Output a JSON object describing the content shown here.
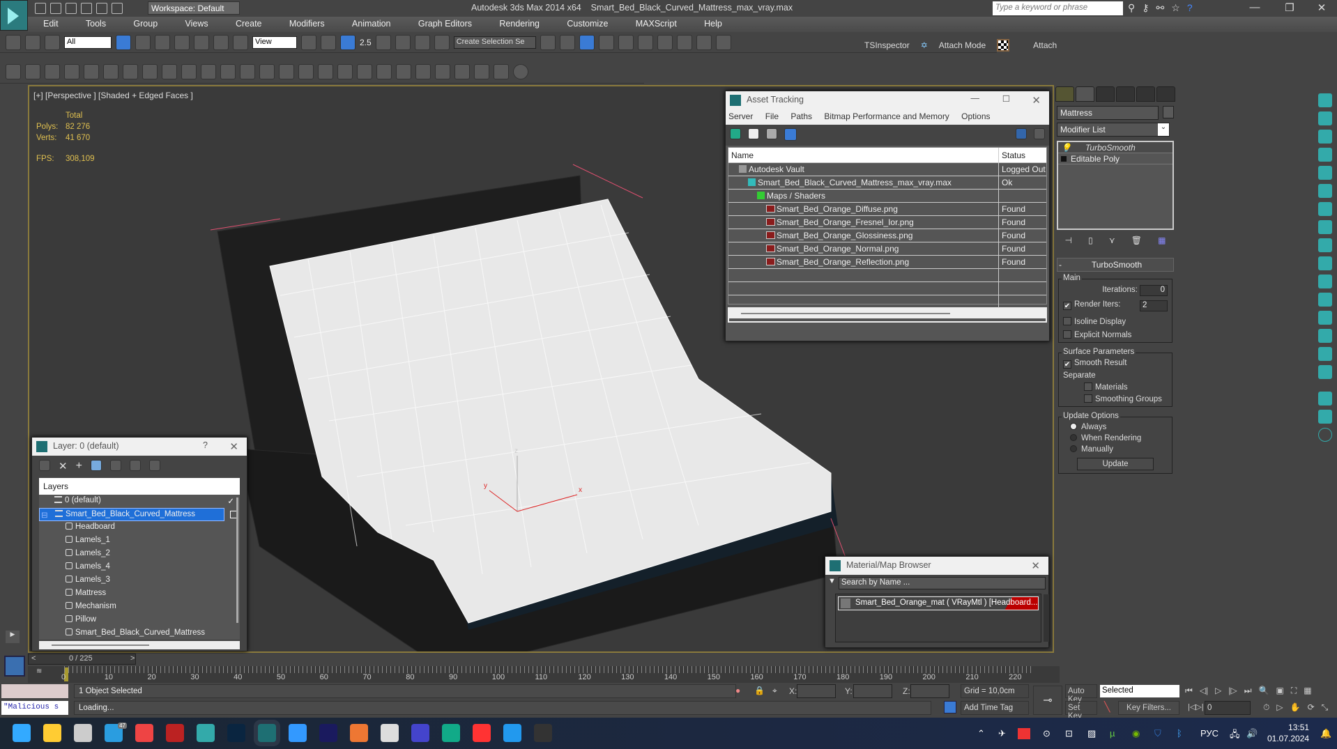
{
  "app": {
    "title": "Autodesk 3ds Max  2014 x64",
    "filename": "Smart_Bed_Black_Curved_Mattress_max_vray.max",
    "workspace": "Workspace: Default",
    "search_placeholder": "Type a keyword or phrase",
    "window_controls": {
      "minimize": "—",
      "restore": "❐",
      "close": "✕"
    }
  },
  "menu": [
    "Edit",
    "Tools",
    "Group",
    "Views",
    "Create",
    "Modifiers",
    "Animation",
    "Graph Editors",
    "Rendering",
    "Customize",
    "MAXScript",
    "Help"
  ],
  "toolbar": {
    "selection_filter": "All",
    "ref_coord": "View",
    "snap_value": "2.5",
    "named_selection_placeholder": "Create Selection Se",
    "tsinspector": "TSInspector",
    "attach_mode": "Attach Mode",
    "attach": "Attach"
  },
  "viewport": {
    "label": "[+] [Perspective ] [Shaded + Edged Faces ]",
    "stats": {
      "total_label": "Total",
      "polys_label": "Polys:",
      "polys": "82 276",
      "verts_label": "Verts:",
      "verts": "41 670",
      "fps_label": "FPS:",
      "fps": "308,109"
    },
    "axis": {
      "x": "x",
      "y": "y",
      "z": "z"
    }
  },
  "asset_tracking": {
    "title": "Asset Tracking",
    "menu": [
      "Server",
      "File",
      "Paths",
      "Bitmap Performance and Memory",
      "Options"
    ],
    "columns": {
      "name": "Name",
      "status": "Status"
    },
    "rows": [
      {
        "name": "Autodesk Vault",
        "status": "Logged Out",
        "level": 1,
        "icon": "vault-icon"
      },
      {
        "name": "Smart_Bed_Black_Curved_Mattress_max_vray.max",
        "status": "Ok",
        "level": 2,
        "icon": "max-file-icon"
      },
      {
        "name": "Maps / Shaders",
        "status": "",
        "level": 3,
        "icon": "maps-icon"
      },
      {
        "name": "Smart_Bed_Orange_Diffuse.png",
        "status": "Found",
        "level": 4,
        "icon": "png-icon"
      },
      {
        "name": "Smart_Bed_Orange_Fresnel_Ior.png",
        "status": "Found",
        "level": 4,
        "icon": "png-icon"
      },
      {
        "name": "Smart_Bed_Orange_Glossiness.png",
        "status": "Found",
        "level": 4,
        "icon": "png-icon"
      },
      {
        "name": "Smart_Bed_Orange_Normal.png",
        "status": "Found",
        "level": 4,
        "icon": "png-icon"
      },
      {
        "name": "Smart_Bed_Orange_Reflection.png",
        "status": "Found",
        "level": 4,
        "icon": "png-icon"
      }
    ]
  },
  "layer_dialog": {
    "title": "Layer: 0 (default)",
    "help": "?",
    "column": "Layers",
    "layers": [
      {
        "name": "0 (default)",
        "type": "layer",
        "active": true
      },
      {
        "name": "Smart_Bed_Black_Curved_Mattress",
        "type": "layer",
        "selected": true
      },
      {
        "name": "Headboard",
        "type": "object"
      },
      {
        "name": "Lamels_1",
        "type": "object"
      },
      {
        "name": "Lamels_2",
        "type": "object"
      },
      {
        "name": "Lamels_4",
        "type": "object"
      },
      {
        "name": "Lamels_3",
        "type": "object"
      },
      {
        "name": "Mattress",
        "type": "object"
      },
      {
        "name": "Mechanism",
        "type": "object"
      },
      {
        "name": "Pillow",
        "type": "object"
      },
      {
        "name": "Smart_Bed_Black_Curved_Mattress",
        "type": "object"
      }
    ]
  },
  "material_browser": {
    "title": "Material/Map Browser",
    "search_placeholder": "Search by Name ...",
    "item": "Smart_Bed_Orange_mat  ( VRayMtl ) [Headboard..."
  },
  "command_panel": {
    "object_name": "Mattress",
    "modifier_list": "Modifier List",
    "stack": [
      {
        "name": "TurboSmooth",
        "italic": true
      },
      {
        "name": "Editable Poly",
        "italic": false
      }
    ],
    "rollout_title": "TurboSmooth",
    "main_label": "Main",
    "iterations_label": "Iterations:",
    "iterations": "0",
    "render_iters_label": "Render Iters:",
    "render_iters": "2",
    "render_iters_checked": true,
    "isoline_label": "Isoline Display",
    "explicit_normals_label": "Explicit Normals",
    "surface_label": "Surface Parameters",
    "smooth_result_label": "Smooth Result",
    "separate_label": "Separate",
    "materials_label": "Materials",
    "smoothing_groups_label": "Smoothing Groups",
    "update_options_label": "Update Options",
    "always_label": "Always",
    "when_rendering_label": "When Rendering",
    "manually_label": "Manually",
    "update_button": "Update"
  },
  "timeline": {
    "frame_display": "0 / 225",
    "prev": "<",
    "next": ">",
    "ticks": [
      "0",
      "10",
      "20",
      "30",
      "40",
      "50",
      "60",
      "70",
      "80",
      "90",
      "100",
      "110",
      "120",
      "130",
      "140",
      "150",
      "160",
      "170",
      "180",
      "190",
      "200",
      "210",
      "220"
    ]
  },
  "status_bar": {
    "maxscript_text": "\"Malicious s",
    "selection_status": "1 Object Selected",
    "prompt": "Loading...",
    "x_label": "X:",
    "y_label": "Y:",
    "z_label": "Z:",
    "grid": "Grid = 10,0cm",
    "add_time_tag": "Add Time Tag",
    "auto_key": "Auto Key",
    "set_key": "Set Key",
    "key_mode": "Selected",
    "key_filters": "Key Filters...",
    "current_frame": "0"
  },
  "taskbar": {
    "apps": [
      "start",
      "file-explorer",
      "widgets",
      "telegram",
      "chrome",
      "aida64",
      "3ds-max-2014",
      "photoshop",
      "3ds-max",
      "notepad",
      "after-effects",
      "g-app",
      "search-app",
      "save-app",
      "edge",
      "yandex",
      "b-app",
      "terminal"
    ],
    "telegram_badge": "47",
    "language": "РУС",
    "time": "13:51",
    "date": "01.07.2024"
  }
}
